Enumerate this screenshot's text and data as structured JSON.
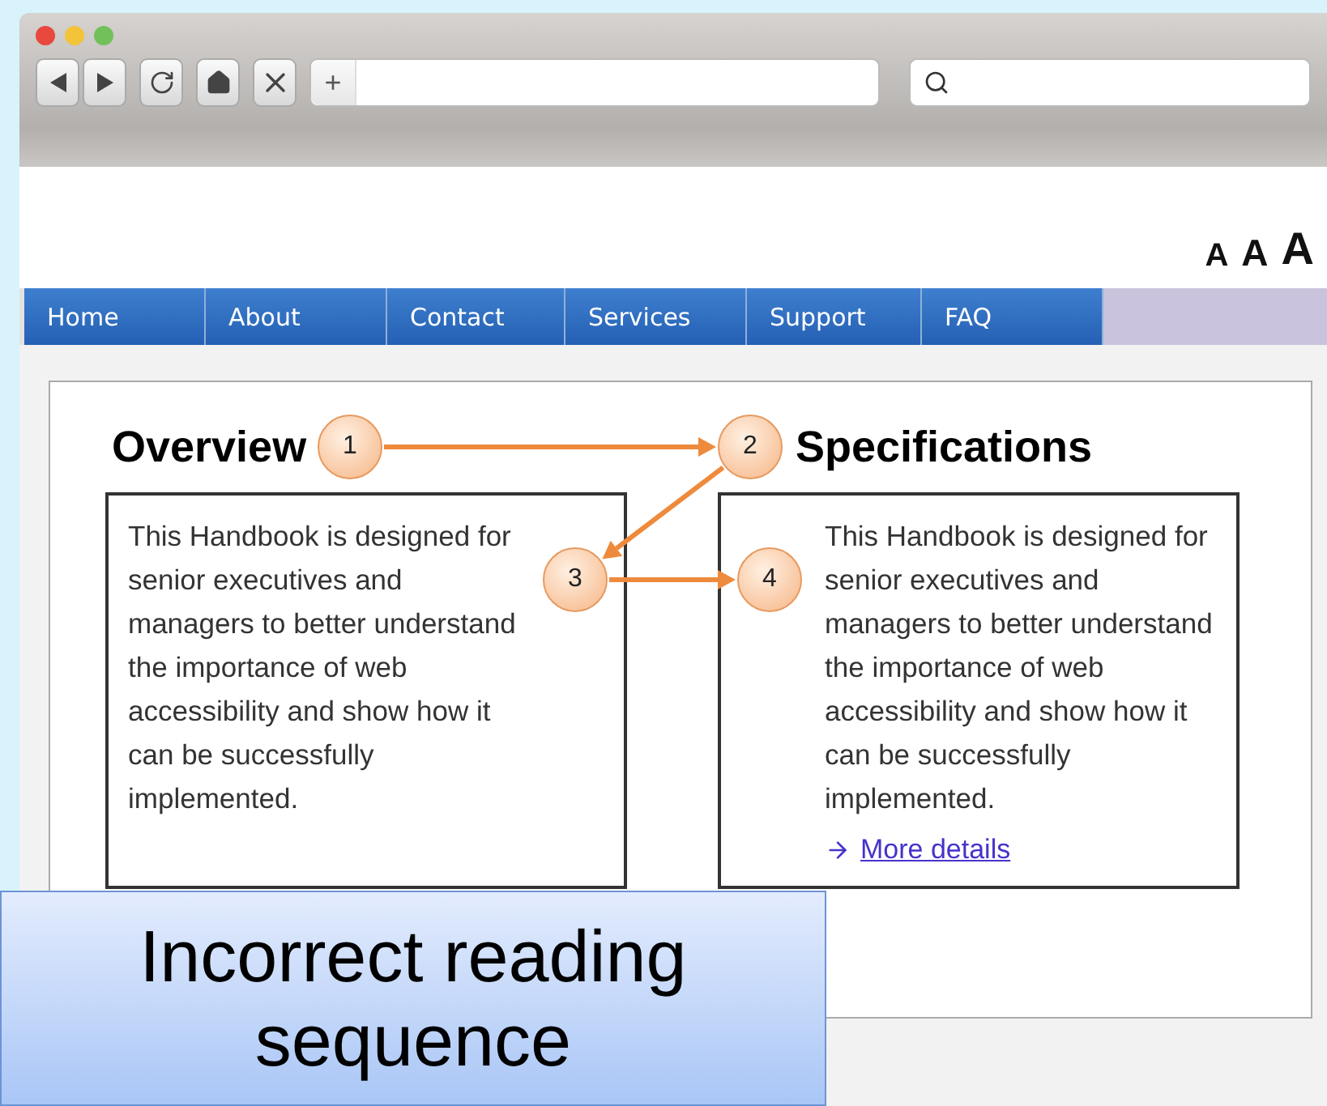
{
  "toolbar": {
    "add_button": "+"
  },
  "font_size_options": [
    {
      "label": "A",
      "kind": "small"
    },
    {
      "label": "A",
      "kind": "medium"
    },
    {
      "label": "A",
      "kind": "large"
    }
  ],
  "nav": [
    "Home",
    "About",
    "Contact",
    "Services",
    "Support",
    "FAQ"
  ],
  "columns": [
    {
      "heading": "Overview",
      "text": "This Handbook is designed for senior executives and managers to better understand the importance of web accessibility and show how it can be successfully implemented."
    },
    {
      "heading": "Specifications",
      "text": "This Handbook is designed for senior executives and managers to better understand the importance of web accessibility and show how it can be successfully implemented.",
      "link": "More details"
    }
  ],
  "markers": [
    "1",
    "2",
    "3",
    "4"
  ],
  "caption": "Incorrect reading sequence"
}
